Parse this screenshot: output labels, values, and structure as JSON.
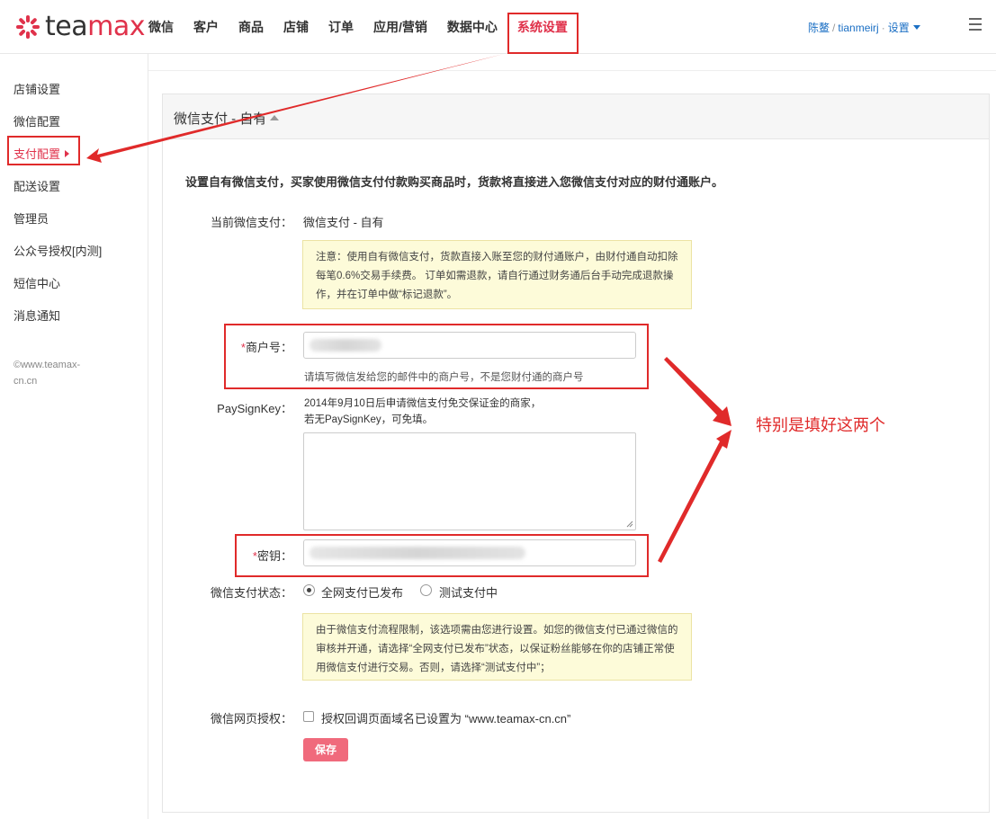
{
  "header": {
    "logo_text_dark": "tea",
    "logo_text_red": "max",
    "nav": [
      "微信",
      "客户",
      "商品",
      "店铺",
      "订单",
      "应用/营销",
      "数据中心",
      "系统设置"
    ],
    "user_name": "陈鳌",
    "user_account": "tianmeirj",
    "settings_label": "设置"
  },
  "sidebar": {
    "items": [
      "店铺设置",
      "微信配置",
      "支付配置",
      "配送设置",
      "管理员",
      "公众号授权[内测]",
      "短信中心",
      "消息通知"
    ],
    "copyright": "©www.teamax-cn.cn"
  },
  "panel": {
    "title": "微信支付 - 自有",
    "description": "设置自有微信支付，买家使用微信支付付款购买商品时，货款将直接进入您微信支付对应的财付通账户。",
    "current_label": "当前微信支付：",
    "current_value": "微信支付 - 自有",
    "notice1": "注意：使用自有微信支付，货款直接入账至您的财付通账户，由财付通自动扣除每笔0.6%交易手续费。 订单如需退款，请自行通过财务通后台手动完成退款操作，并在订单中做“标记退款”。",
    "merchant_label": "商户号：",
    "merchant_help": "请填写微信发给您的邮件中的商户号，不是您财付通的商户号",
    "paysign_label": "PaySignKey：",
    "paysign_hint1": "2014年9月10日后申请微信支付免交保证金的商家，",
    "paysign_hint2": "若无PaySignKey，可免填。",
    "secret_label": "密钥：",
    "status_label": "微信支付状态：",
    "status_options": [
      "全网支付已发布",
      "测试支付中"
    ],
    "notice2": "由于微信支付流程限制，该选项需由您进行设置。如您的微信支付已通过微信的审核并开通，请选择“全网支付已发布”状态，以保证粉丝能够在你的店铺正常使用微信支付进行交易。否则，请选择“测试支付中”；",
    "auth_label": "微信网页授权：",
    "auth_checkbox_text": "授权回调页面域名已设置为 “www.teamax-cn.cn”",
    "save_label": "保存"
  },
  "annotation": {
    "text": "特别是填好这两个"
  },
  "colors": {
    "brand_red": "#e0324b",
    "annotation_red": "#e02a2a",
    "link_blue": "#1b6fc4",
    "notice_bg": "#fdfbd9"
  }
}
